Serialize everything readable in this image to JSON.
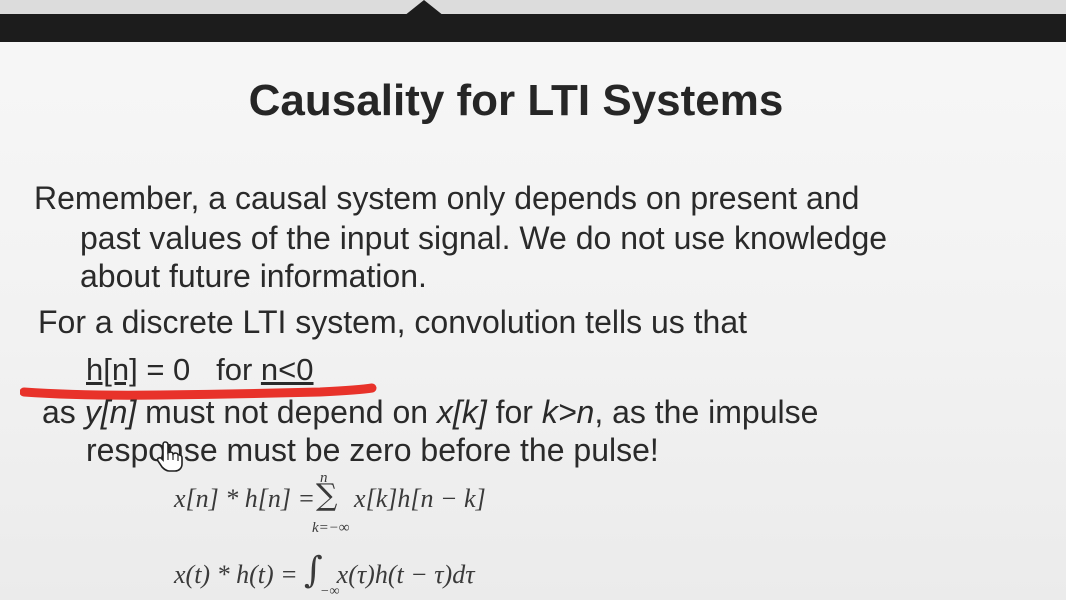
{
  "slide": {
    "title": "Causality for LTI Systems",
    "paragraph1": {
      "line1": "Remember, a causal system only depends on present and",
      "line2": "past values of the input signal.  We do not use knowledge",
      "line3": "about future information."
    },
    "paragraph2": "For a discrete LTI system, convolution tells us that",
    "condition": {
      "lhs": "h[n]",
      "eq": " = 0   for ",
      "rhs": "n<0"
    },
    "paragraph3": {
      "as": "as ",
      "y": "y[n]",
      "mid1": " must not depend on ",
      "xk": "x[k]",
      "mid2": " for ",
      "kn": "k>n",
      "end": ", as the impulse",
      "line2": "response must be zero before the pulse!"
    },
    "formula_discrete": {
      "expression": "x[n] * h[n] =      x[k]h[n − k]",
      "sigma": "∑",
      "upper": "n",
      "lower": "k=−∞"
    },
    "formula_continuous": {
      "expression": "x(t) * h(t) =      x(τ)h(t − τ)dτ",
      "integral": "∫",
      "lower": "−∞"
    },
    "annotation_color": "#e8322a",
    "top_bar_color": "#1c1c1c"
  },
  "cursor": "hand-pointer-icon"
}
